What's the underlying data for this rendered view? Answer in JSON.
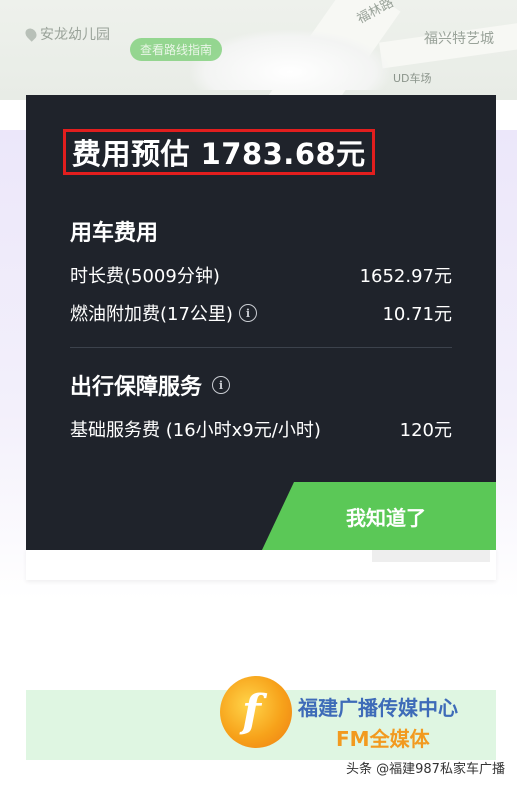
{
  "map": {
    "kindergarten": "安龙幼儿园",
    "road": "福林路",
    "chip": "查看路线指南",
    "poi_right": "福兴特艺城",
    "poi_sub": "UD车场"
  },
  "dialog": {
    "title": "费用预估 1783.68元",
    "rental_section": "用车费用",
    "duration_label": "时长费(5009分钟)",
    "duration_value": "1652.97元",
    "fuel_label": "燃油附加费(17公里)",
    "fuel_value": "10.71元",
    "protection_section": "出行保障服务",
    "service_label": "基础服务费 (16小时x9元/小时)",
    "service_value": "120元",
    "confirm_button": "我知道了",
    "info_glyph": "i"
  },
  "watermark": {
    "logo_letter": "f",
    "line1": "福建广播传媒中心",
    "line2": "FM全媒体",
    "credit": "头条 @福建987私家车广播"
  },
  "colors": {
    "dialog_bg": "#1f232b",
    "accent_green": "#5bc857",
    "highlight_red": "#e21e1e",
    "sheet_lavender": "#ece7fa"
  }
}
